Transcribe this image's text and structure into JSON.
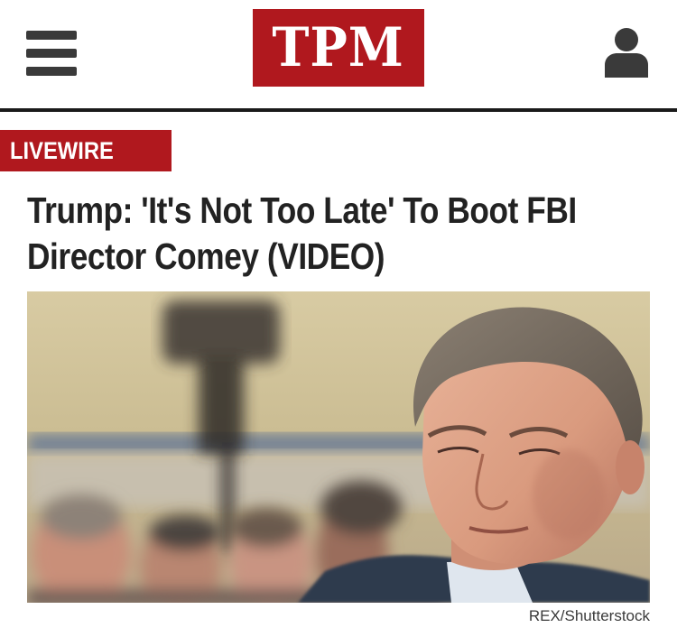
{
  "header": {
    "logo_text": "TPM",
    "menu_icon": "hamburger-menu-icon",
    "account_icon": "user-account-icon",
    "brand_color": "#b0181e"
  },
  "article": {
    "section": "LIVEWIRE",
    "headline": "Trump: 'It's Not Too Late' To Boot FBI Director Comey (VIDEO)",
    "photo_credit": "REX/Shutterstock"
  }
}
